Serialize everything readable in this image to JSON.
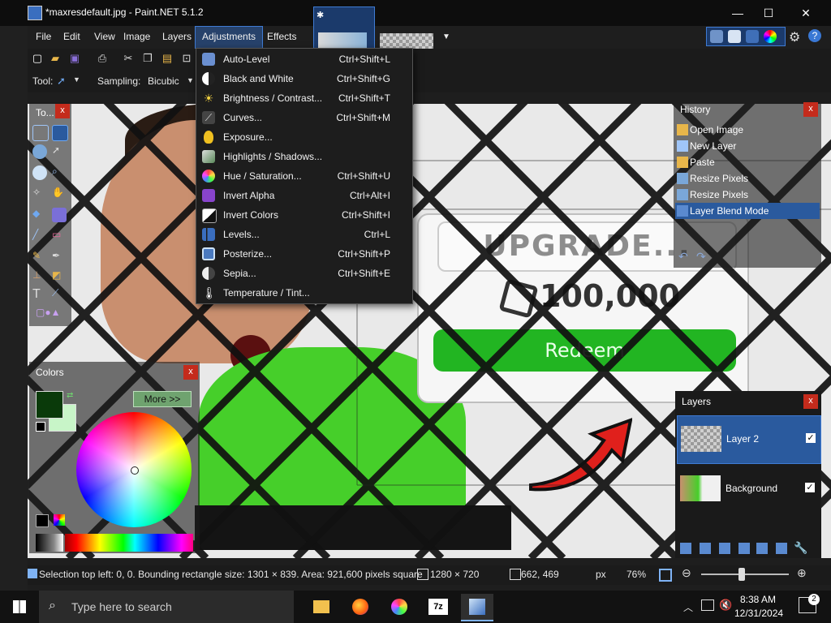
{
  "window": {
    "title": "*maxresdefault.jpg - Paint.NET 5.1.2",
    "controls": [
      "—",
      "☐",
      "✕"
    ]
  },
  "menubar": {
    "items": [
      "File",
      "Edit",
      "View",
      "Image",
      "Layers",
      "Adjustments",
      "Effects"
    ],
    "active": "Adjustments"
  },
  "toolbar": {
    "tool_label": "Tool:",
    "sampling_label": "Sampling:",
    "sampling_value": "Bicubic"
  },
  "adjustments_menu": [
    {
      "label": "Auto-Level",
      "shortcut": "Ctrl+Shift+L",
      "icon": "auto-level-icon",
      "color": "#6a8fd0"
    },
    {
      "label": "Black and White",
      "shortcut": "Ctrl+Shift+G",
      "icon": "black-white-icon",
      "color": "#d8d8d8"
    },
    {
      "label": "Brightness / Contrast...",
      "shortcut": "Ctrl+Shift+T",
      "icon": "brightness-icon",
      "color": "#f0d040"
    },
    {
      "label": "Curves...",
      "shortcut": "Ctrl+Shift+M",
      "icon": "curves-icon",
      "color": "#555555"
    },
    {
      "label": "Exposure...",
      "shortcut": "",
      "icon": "exposure-icon",
      "color": "#f0c020"
    },
    {
      "label": "Highlights / Shadows...",
      "shortcut": "",
      "icon": "highlights-shadows-icon",
      "color": "#5a8a5a"
    },
    {
      "label": "Hue / Saturation...",
      "shortcut": "Ctrl+Shift+U",
      "icon": "hue-saturation-icon",
      "color": "#e05050"
    },
    {
      "label": "Invert Alpha",
      "shortcut": "Ctrl+Alt+I",
      "icon": "invert-alpha-icon",
      "color": "#8844cc"
    },
    {
      "label": "Invert Colors",
      "shortcut": "Ctrl+Shift+I",
      "icon": "invert-colors-icon",
      "color": "#222222"
    },
    {
      "label": "Levels...",
      "shortcut": "Ctrl+L",
      "icon": "levels-icon",
      "color": "#3a6ebf"
    },
    {
      "label": "Posterize...",
      "shortcut": "Ctrl+Shift+P",
      "icon": "posterize-icon",
      "color": "#4a7ac0"
    },
    {
      "label": "Sepia...",
      "shortcut": "Ctrl+Shift+E",
      "icon": "sepia-icon",
      "color": "#a08050"
    },
    {
      "label": "Temperature / Tint...",
      "shortcut": "",
      "icon": "temperature-icon",
      "color": "#ffffff"
    }
  ],
  "tools_panel": {
    "title": "To..."
  },
  "colors_panel": {
    "title": "Colors",
    "more_button": "More >>",
    "primary_color": "#0a3a0a",
    "secondary_color": "#c8f5c8"
  },
  "history_panel": {
    "title": "History",
    "items": [
      "Open Image",
      "New Layer",
      "Paste",
      "Resize Pixels",
      "Resize Pixels",
      "Layer Blend Mode"
    ],
    "selected_index": 5
  },
  "layers_panel": {
    "title": "Layers",
    "layers": [
      {
        "name": "Layer 2",
        "visible": true,
        "selected": true
      },
      {
        "name": "Background",
        "visible": true,
        "selected": false
      }
    ]
  },
  "canvas_content": {
    "code_text": "UPGRADE...",
    "robux_text": "100,000",
    "redeem_text": "Redeem"
  },
  "statusbar": {
    "selection_text": "Selection top left: 0, 0. Bounding rectangle size: 1301 × 839. Area: 921,600 pixels square",
    "image_size": "1280 × 720",
    "cursor_pos": "662, 469",
    "unit": "px",
    "zoom": "76%"
  },
  "taskbar": {
    "search_placeholder": "Type here to search",
    "time": "8:38 AM",
    "date": "12/31/2024",
    "notification_count": "2"
  }
}
